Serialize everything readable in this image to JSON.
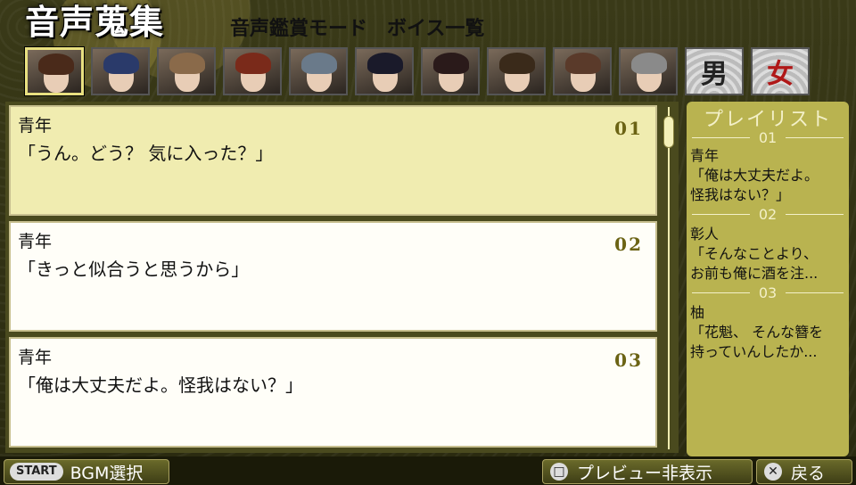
{
  "header": {
    "logo": "音声蒐集",
    "mode_title": "音声鑑賞モード　ボイス一覧"
  },
  "portraits": [
    {
      "name": "portrait-1",
      "hair": "#4a2a1a",
      "selected": true
    },
    {
      "name": "portrait-2",
      "hair": "#2a3a6a"
    },
    {
      "name": "portrait-3",
      "hair": "#8a6a4a"
    },
    {
      "name": "portrait-4",
      "hair": "#7a2a1a"
    },
    {
      "name": "portrait-5",
      "hair": "#6a7a8a"
    },
    {
      "name": "portrait-6",
      "hair": "#1a1a2a"
    },
    {
      "name": "portrait-7",
      "hair": "#2a1a1a"
    },
    {
      "name": "portrait-8",
      "hair": "#3a2a1a"
    },
    {
      "name": "portrait-9",
      "hair": "#5a3a2a"
    },
    {
      "name": "portrait-10",
      "hair": "#8a8a8a"
    }
  ],
  "gender_buttons": [
    {
      "label": "男",
      "color": "#222222"
    },
    {
      "label": "女",
      "color": "#b01818"
    }
  ],
  "voices": [
    {
      "speaker": "青年",
      "line": "「うん。どう？ 気に入った？」",
      "number": "01",
      "active": true
    },
    {
      "speaker": "青年",
      "line": "「きっと似合うと思うから」",
      "number": "02"
    },
    {
      "speaker": "青年",
      "line": "「俺は大丈夫だよ。怪我はない？」",
      "number": "03"
    }
  ],
  "playlist": {
    "title": "プレイリスト",
    "items": [
      {
        "number": "01",
        "speaker": "青年",
        "line1": "「俺は大丈夫だよ。",
        "line2": "怪我はない？」"
      },
      {
        "number": "02",
        "speaker": "彰人",
        "line1": "「そんなことより、",
        "line2": "お前も俺に酒を注..."
      },
      {
        "number": "03",
        "speaker": "柚",
        "line1": "「花魁、 そんな簪を",
        "line2": "持っていんしたか..."
      }
    ]
  },
  "footer": {
    "start_badge": "START",
    "bgm_label": "BGM選択",
    "preview_icon": "square-button-icon",
    "preview_label": "プレビュー非表示",
    "back_icon": "cross-button-icon",
    "back_label": "戻る"
  },
  "colors": {
    "accent": "#6b6314",
    "active_entry": "#f0ecb0",
    "playlist_bg": "#b9b350"
  }
}
